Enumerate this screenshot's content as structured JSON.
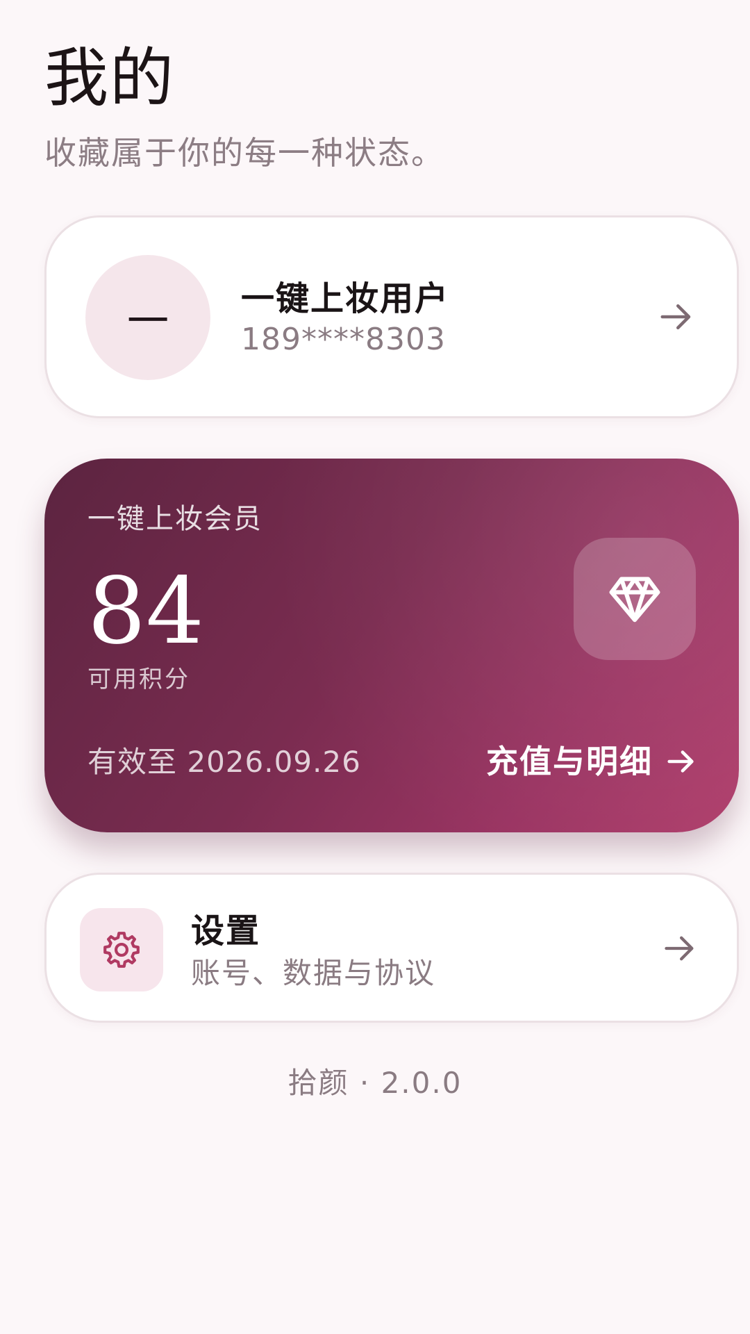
{
  "header": {
    "title": "我的",
    "subtitle": "收藏属于你的每一种状态。"
  },
  "profile": {
    "avatar_initial": "一",
    "name": "一键上妆用户",
    "phone": "189****8303",
    "arrow_icon": "arrow-right-icon"
  },
  "membership": {
    "title": "一键上妆会员",
    "points": "84",
    "points_label": "可用积分",
    "expiry": "有效至 2026.09.26",
    "recharge_label": "充值与明细",
    "badge_icon": "diamond-icon",
    "colors": {
      "gradient_start": "#5c2440",
      "gradient_end": "#b03f6c"
    }
  },
  "settings": {
    "title": "设置",
    "description": "账号、数据与协议",
    "icon": "gear-icon",
    "icon_color": "#b03a62"
  },
  "footer": {
    "version": "拾颜 · 2.0.0"
  }
}
